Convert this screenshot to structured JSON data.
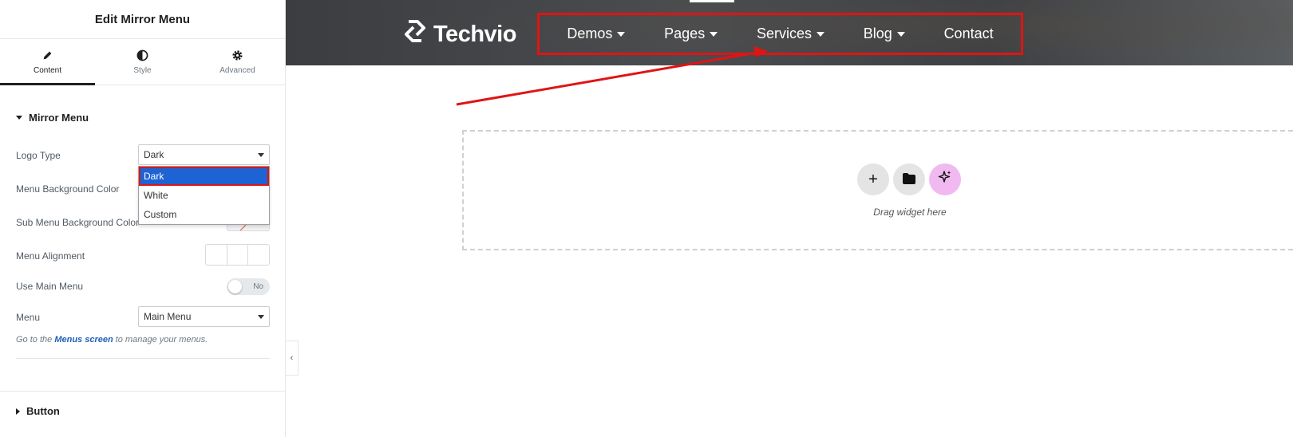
{
  "panel": {
    "title": "Edit Mirror Menu",
    "tabs": [
      {
        "label": "Content",
        "icon": "pencil-icon",
        "active": true
      },
      {
        "label": "Style",
        "icon": "half-circle-icon",
        "active": false
      },
      {
        "label": "Advanced",
        "icon": "gear-icon",
        "active": false
      }
    ],
    "section_mirror_menu": "Mirror Menu",
    "logo_type": {
      "label": "Logo Type",
      "value": "Dark",
      "options": [
        "Dark",
        "White",
        "Custom"
      ],
      "highlighted_option": "Dark"
    },
    "menu_bg_color_label": "Menu Background Color",
    "sub_menu_bg_color_label": "Sub Menu Background Color",
    "menu_alignment_label": "Menu Alignment",
    "use_main_menu": {
      "label": "Use Main Menu",
      "state": "No"
    },
    "menu": {
      "label": "Menu",
      "value": "Main Menu"
    },
    "help": {
      "prefix": "Go to the ",
      "link": "Menus screen",
      "suffix": " to manage your menus."
    },
    "section_button": "Button"
  },
  "preview": {
    "logo_text": "Techvio",
    "nav": [
      {
        "label": "Demos",
        "has_dropdown": true
      },
      {
        "label": "Pages",
        "has_dropdown": true
      },
      {
        "label": "Services",
        "has_dropdown": true
      },
      {
        "label": "Blog",
        "has_dropdown": true
      },
      {
        "label": "Contact",
        "has_dropdown": false
      }
    ],
    "dropzone_text": "Drag widget here"
  },
  "colors": {
    "highlight_red": "#e01414",
    "selection_blue": "#1e63d4",
    "ai_button": "#f0b9f0"
  }
}
